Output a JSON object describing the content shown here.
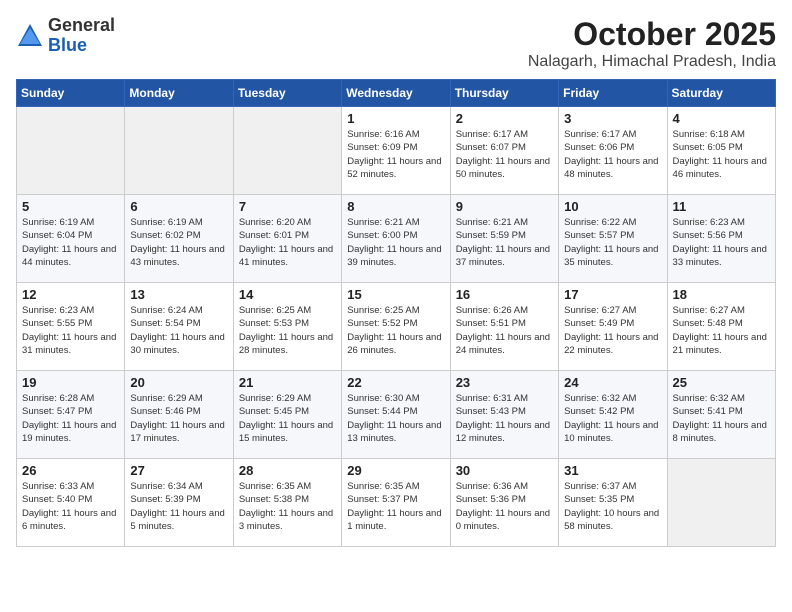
{
  "header": {
    "logo_general": "General",
    "logo_blue": "Blue",
    "month_title": "October 2025",
    "location": "Nalagarh, Himachal Pradesh, India"
  },
  "weekdays": [
    "Sunday",
    "Monday",
    "Tuesday",
    "Wednesday",
    "Thursday",
    "Friday",
    "Saturday"
  ],
  "weeks": [
    [
      {
        "day": "",
        "info": ""
      },
      {
        "day": "",
        "info": ""
      },
      {
        "day": "",
        "info": ""
      },
      {
        "day": "1",
        "info": "Sunrise: 6:16 AM\nSunset: 6:09 PM\nDaylight: 11 hours and 52 minutes."
      },
      {
        "day": "2",
        "info": "Sunrise: 6:17 AM\nSunset: 6:07 PM\nDaylight: 11 hours and 50 minutes."
      },
      {
        "day": "3",
        "info": "Sunrise: 6:17 AM\nSunset: 6:06 PM\nDaylight: 11 hours and 48 minutes."
      },
      {
        "day": "4",
        "info": "Sunrise: 6:18 AM\nSunset: 6:05 PM\nDaylight: 11 hours and 46 minutes."
      }
    ],
    [
      {
        "day": "5",
        "info": "Sunrise: 6:19 AM\nSunset: 6:04 PM\nDaylight: 11 hours and 44 minutes."
      },
      {
        "day": "6",
        "info": "Sunrise: 6:19 AM\nSunset: 6:02 PM\nDaylight: 11 hours and 43 minutes."
      },
      {
        "day": "7",
        "info": "Sunrise: 6:20 AM\nSunset: 6:01 PM\nDaylight: 11 hours and 41 minutes."
      },
      {
        "day": "8",
        "info": "Sunrise: 6:21 AM\nSunset: 6:00 PM\nDaylight: 11 hours and 39 minutes."
      },
      {
        "day": "9",
        "info": "Sunrise: 6:21 AM\nSunset: 5:59 PM\nDaylight: 11 hours and 37 minutes."
      },
      {
        "day": "10",
        "info": "Sunrise: 6:22 AM\nSunset: 5:57 PM\nDaylight: 11 hours and 35 minutes."
      },
      {
        "day": "11",
        "info": "Sunrise: 6:23 AM\nSunset: 5:56 PM\nDaylight: 11 hours and 33 minutes."
      }
    ],
    [
      {
        "day": "12",
        "info": "Sunrise: 6:23 AM\nSunset: 5:55 PM\nDaylight: 11 hours and 31 minutes."
      },
      {
        "day": "13",
        "info": "Sunrise: 6:24 AM\nSunset: 5:54 PM\nDaylight: 11 hours and 30 minutes."
      },
      {
        "day": "14",
        "info": "Sunrise: 6:25 AM\nSunset: 5:53 PM\nDaylight: 11 hours and 28 minutes."
      },
      {
        "day": "15",
        "info": "Sunrise: 6:25 AM\nSunset: 5:52 PM\nDaylight: 11 hours and 26 minutes."
      },
      {
        "day": "16",
        "info": "Sunrise: 6:26 AM\nSunset: 5:51 PM\nDaylight: 11 hours and 24 minutes."
      },
      {
        "day": "17",
        "info": "Sunrise: 6:27 AM\nSunset: 5:49 PM\nDaylight: 11 hours and 22 minutes."
      },
      {
        "day": "18",
        "info": "Sunrise: 6:27 AM\nSunset: 5:48 PM\nDaylight: 11 hours and 21 minutes."
      }
    ],
    [
      {
        "day": "19",
        "info": "Sunrise: 6:28 AM\nSunset: 5:47 PM\nDaylight: 11 hours and 19 minutes."
      },
      {
        "day": "20",
        "info": "Sunrise: 6:29 AM\nSunset: 5:46 PM\nDaylight: 11 hours and 17 minutes."
      },
      {
        "day": "21",
        "info": "Sunrise: 6:29 AM\nSunset: 5:45 PM\nDaylight: 11 hours and 15 minutes."
      },
      {
        "day": "22",
        "info": "Sunrise: 6:30 AM\nSunset: 5:44 PM\nDaylight: 11 hours and 13 minutes."
      },
      {
        "day": "23",
        "info": "Sunrise: 6:31 AM\nSunset: 5:43 PM\nDaylight: 11 hours and 12 minutes."
      },
      {
        "day": "24",
        "info": "Sunrise: 6:32 AM\nSunset: 5:42 PM\nDaylight: 11 hours and 10 minutes."
      },
      {
        "day": "25",
        "info": "Sunrise: 6:32 AM\nSunset: 5:41 PM\nDaylight: 11 hours and 8 minutes."
      }
    ],
    [
      {
        "day": "26",
        "info": "Sunrise: 6:33 AM\nSunset: 5:40 PM\nDaylight: 11 hours and 6 minutes."
      },
      {
        "day": "27",
        "info": "Sunrise: 6:34 AM\nSunset: 5:39 PM\nDaylight: 11 hours and 5 minutes."
      },
      {
        "day": "28",
        "info": "Sunrise: 6:35 AM\nSunset: 5:38 PM\nDaylight: 11 hours and 3 minutes."
      },
      {
        "day": "29",
        "info": "Sunrise: 6:35 AM\nSunset: 5:37 PM\nDaylight: 11 hours and 1 minute."
      },
      {
        "day": "30",
        "info": "Sunrise: 6:36 AM\nSunset: 5:36 PM\nDaylight: 11 hours and 0 minutes."
      },
      {
        "day": "31",
        "info": "Sunrise: 6:37 AM\nSunset: 5:35 PM\nDaylight: 10 hours and 58 minutes."
      },
      {
        "day": "",
        "info": ""
      }
    ]
  ]
}
